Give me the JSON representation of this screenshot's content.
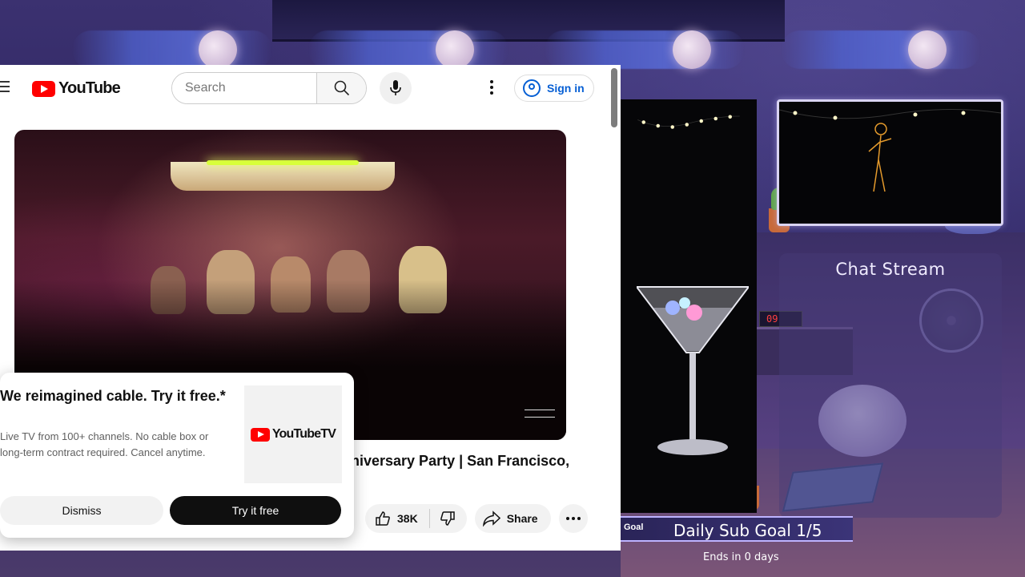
{
  "youtube": {
    "logo_text": "YouTube",
    "search": {
      "placeholder": "Search"
    },
    "sign_in_label": "Sign in",
    "video": {
      "title_visible": "niversary Party | San Francisco,",
      "like_count": "38K",
      "share_label": "Share"
    },
    "promo": {
      "title": "We reimagined cable. Try it free.*",
      "body": "Live TV from 100+ channels. No cable box or long-term contract required. Cancel anytime.",
      "logo_text": "YouTubeTV",
      "dismiss_label": "Dismiss",
      "try_label": "Try it free"
    }
  },
  "overlay": {
    "chat_title": "Chat Stream",
    "goal_tag": "Goal",
    "goal_label": "Daily Sub Goal 1/5",
    "goal_ends": "Ends in 0 days",
    "clock_text": "09"
  },
  "colors": {
    "youtube_red": "#ff0000",
    "link_blue": "#065fd4",
    "try_button": "#0f0f0f",
    "overlay_purple": "#3b3170"
  },
  "icons": [
    "hamburger-icon",
    "youtube-logo-icon",
    "search-icon",
    "mic-icon",
    "more-vert-icon",
    "account-icon",
    "like-icon",
    "dislike-icon",
    "share-icon",
    "more-horiz-icon",
    "youtube-tv-logo-icon"
  ]
}
